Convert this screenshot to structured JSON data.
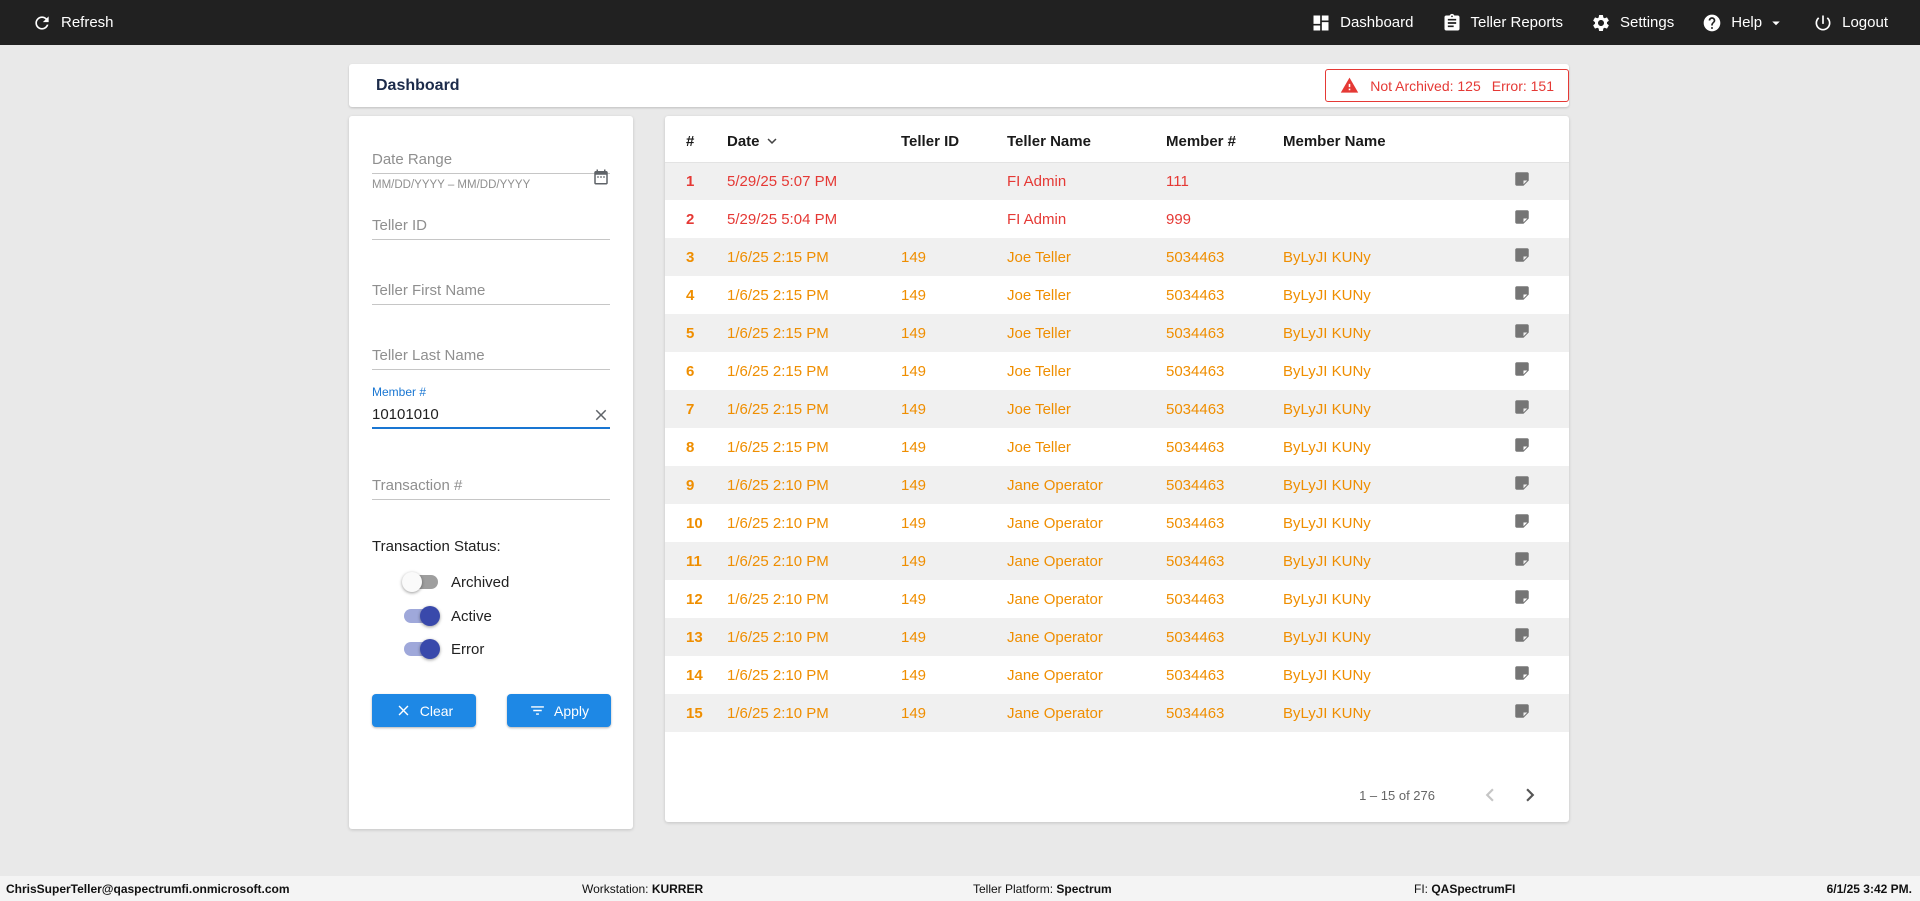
{
  "colors": {
    "topbar-bg": "#212121",
    "accent-blue": "#1e88e5",
    "error-red": "#e53935",
    "warn-orange": "#ef8e00",
    "toggle-on": "#3949ab",
    "toggle-on-track": "#9fa8da",
    "title-navy": "#1c2b4a",
    "field-label-blue": "#1976d2"
  },
  "topbar": {
    "refresh_label": "Refresh",
    "nav": [
      {
        "label": "Dashboard"
      },
      {
        "label": "Teller Reports"
      },
      {
        "label": "Settings"
      },
      {
        "label": "Help"
      },
      {
        "label": "Logout"
      }
    ]
  },
  "header": {
    "title": "Dashboard",
    "alert": {
      "not_archived": "Not Archived: 125",
      "error": "Error: 151"
    }
  },
  "filters": {
    "date_range": {
      "placeholder": "Date Range",
      "hint": "MM/DD/YYYY – MM/DD/YYYY"
    },
    "teller_id": {
      "placeholder": "Teller ID"
    },
    "teller_first_name": {
      "placeholder": "Teller First Name"
    },
    "teller_last_name": {
      "placeholder": "Teller Last Name"
    },
    "member_number": {
      "label": "Member #",
      "value": "10101010"
    },
    "transaction_number": {
      "placeholder": "Transaction #"
    },
    "status": {
      "label": "Transaction Status:",
      "toggles": [
        {
          "label": "Archived",
          "on": false
        },
        {
          "label": "Active",
          "on": true
        },
        {
          "label": "Error",
          "on": true
        }
      ]
    },
    "clear_label": "Clear",
    "apply_label": "Apply"
  },
  "table": {
    "columns": [
      "#",
      "Date",
      "Teller ID",
      "Teller Name",
      "Member #",
      "Member Name"
    ],
    "sort": {
      "column": "Date",
      "direction": "desc"
    },
    "rows": [
      {
        "num": "1",
        "date": "5/29/25 5:07 PM",
        "teller_id": "",
        "teller_name": "FI Admin",
        "member_num": "111",
        "member_name": "",
        "status": "error"
      },
      {
        "num": "2",
        "date": "5/29/25 5:04 PM",
        "teller_id": "",
        "teller_name": "FI Admin",
        "member_num": "999",
        "member_name": "",
        "status": "error"
      },
      {
        "num": "3",
        "date": "1/6/25 2:15 PM",
        "teller_id": "149",
        "teller_name": "Joe Teller",
        "member_num": "5034463",
        "member_name": "ByLyJI KUNy",
        "status": "warn"
      },
      {
        "num": "4",
        "date": "1/6/25 2:15 PM",
        "teller_id": "149",
        "teller_name": "Joe Teller",
        "member_num": "5034463",
        "member_name": "ByLyJI KUNy",
        "status": "warn"
      },
      {
        "num": "5",
        "date": "1/6/25 2:15 PM",
        "teller_id": "149",
        "teller_name": "Joe Teller",
        "member_num": "5034463",
        "member_name": "ByLyJI KUNy",
        "status": "warn"
      },
      {
        "num": "6",
        "date": "1/6/25 2:15 PM",
        "teller_id": "149",
        "teller_name": "Joe Teller",
        "member_num": "5034463",
        "member_name": "ByLyJI KUNy",
        "status": "warn"
      },
      {
        "num": "7",
        "date": "1/6/25 2:15 PM",
        "teller_id": "149",
        "teller_name": "Joe Teller",
        "member_num": "5034463",
        "member_name": "ByLyJI KUNy",
        "status": "warn"
      },
      {
        "num": "8",
        "date": "1/6/25 2:15 PM",
        "teller_id": "149",
        "teller_name": "Joe Teller",
        "member_num": "5034463",
        "member_name": "ByLyJI KUNy",
        "status": "warn"
      },
      {
        "num": "9",
        "date": "1/6/25 2:10 PM",
        "teller_id": "149",
        "teller_name": "Jane Operator",
        "member_num": "5034463",
        "member_name": "ByLyJI KUNy",
        "status": "warn"
      },
      {
        "num": "10",
        "date": "1/6/25 2:10 PM",
        "teller_id": "149",
        "teller_name": "Jane Operator",
        "member_num": "5034463",
        "member_name": "ByLyJI KUNy",
        "status": "warn"
      },
      {
        "num": "11",
        "date": "1/6/25 2:10 PM",
        "teller_id": "149",
        "teller_name": "Jane Operator",
        "member_num": "5034463",
        "member_name": "ByLyJI KUNy",
        "status": "warn"
      },
      {
        "num": "12",
        "date": "1/6/25 2:10 PM",
        "teller_id": "149",
        "teller_name": "Jane Operator",
        "member_num": "5034463",
        "member_name": "ByLyJI KUNy",
        "status": "warn"
      },
      {
        "num": "13",
        "date": "1/6/25 2:10 PM",
        "teller_id": "149",
        "teller_name": "Jane Operator",
        "member_num": "5034463",
        "member_name": "ByLyJI KUNy",
        "status": "warn"
      },
      {
        "num": "14",
        "date": "1/6/25 2:10 PM",
        "teller_id": "149",
        "teller_name": "Jane Operator",
        "member_num": "5034463",
        "member_name": "ByLyJI KUNy",
        "status": "warn"
      },
      {
        "num": "15",
        "date": "1/6/25 2:10 PM",
        "teller_id": "149",
        "teller_name": "Jane Operator",
        "member_num": "5034463",
        "member_name": "ByLyJI KUNy",
        "status": "warn"
      }
    ],
    "pagination": {
      "range": "1 – 15 of 276"
    }
  },
  "statusbar": {
    "user": "ChrisSuperTeller@qaspectrumfi.onmicrosoft.com",
    "workstation_label": "Workstation:",
    "workstation": "KURRER",
    "platform_label": "Teller Platform:",
    "platform": "Spectrum",
    "fi_label": "FI:",
    "fi": "QASpectrumFI",
    "datetime": "6/1/25 3:42 PM."
  }
}
